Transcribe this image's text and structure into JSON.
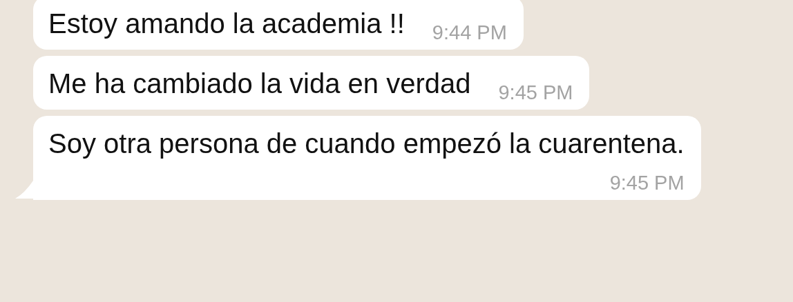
{
  "messages": [
    {
      "text": "Estoy amando la academia !!",
      "time": "9:44 PM",
      "tail": false
    },
    {
      "text": "Me ha cambiado la vida en verdad",
      "time": "9:45 PM",
      "tail": false
    },
    {
      "text": "Soy otra persona de cuando empezó la cuarentena.",
      "time": "9:45 PM",
      "tail": true
    }
  ]
}
